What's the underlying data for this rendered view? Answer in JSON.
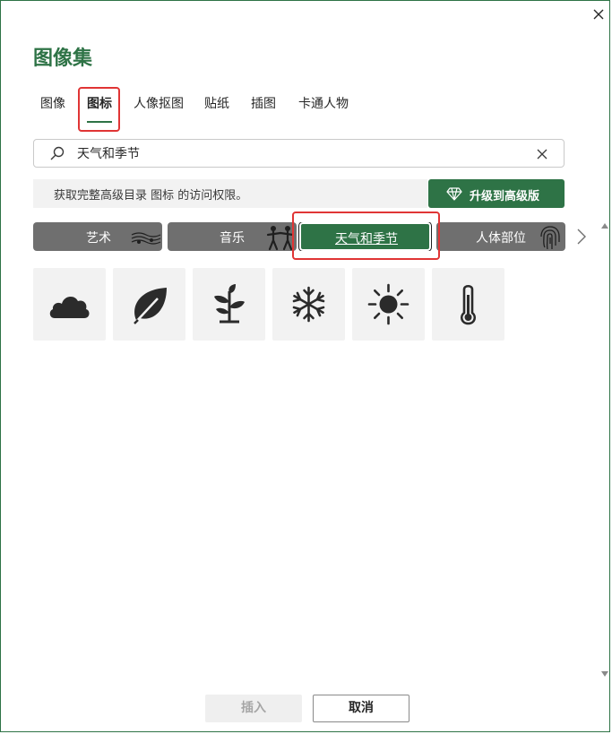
{
  "dialog": {
    "title": "图像集",
    "close_label": "×"
  },
  "tabs": [
    {
      "label": "图像",
      "active": false
    },
    {
      "label": "图标",
      "active": true
    },
    {
      "label": "人像抠图",
      "active": false
    },
    {
      "label": "贴纸",
      "active": false
    },
    {
      "label": "插图",
      "active": false
    },
    {
      "label": "卡通人物",
      "active": false
    }
  ],
  "search": {
    "value": "天气和季节",
    "placeholder": "搜索"
  },
  "banner": {
    "text": "获取完整高级目录 图标 的访问权限。",
    "upgrade_label": "升级到高级版"
  },
  "categories": [
    {
      "label": "艺术",
      "icon": "music-sheet-icon",
      "selected": false
    },
    {
      "label": "音乐",
      "icon": "dancers-icon",
      "selected": false
    },
    {
      "label": "天气和季节",
      "icon": "",
      "selected": true
    },
    {
      "label": "人体部位",
      "icon": "fingerprint-icon",
      "selected": false
    }
  ],
  "icons": [
    {
      "name": "cloud-icon"
    },
    {
      "name": "leaf-icon"
    },
    {
      "name": "sprout-icon"
    },
    {
      "name": "snowflake-icon"
    },
    {
      "name": "sun-icon"
    },
    {
      "name": "thermometer-icon"
    }
  ],
  "footer": {
    "insert_label": "插入",
    "cancel_label": "取消"
  },
  "colors": {
    "accent": "#2e7346",
    "category_bg": "#6f6f6f",
    "highlight": "#e03535",
    "tile_bg": "#f2f2f2"
  }
}
